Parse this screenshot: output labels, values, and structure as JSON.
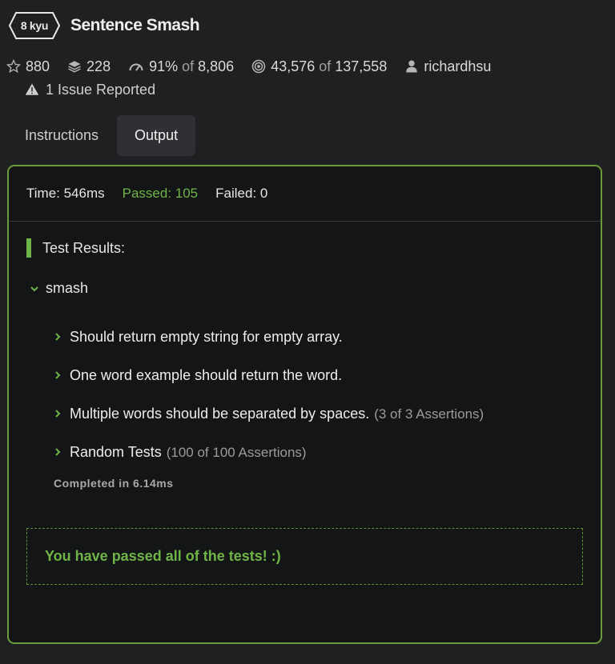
{
  "kata": {
    "rank": "8 kyu",
    "title": "Sentence Smash"
  },
  "stats": {
    "stars": "880",
    "collections": "228",
    "satisfaction_pct": "91%",
    "satisfaction_of": "of",
    "satisfaction_total": "8,806",
    "completed": "43,576",
    "completed_of": "of",
    "attempted": "137,558",
    "author": "richardhsu"
  },
  "issues": "1 Issue Reported",
  "tabs": [
    {
      "label": "Instructions",
      "active": false
    },
    {
      "label": "Output",
      "active": true
    }
  ],
  "summary": {
    "time": "Time: 546ms",
    "passed": "Passed: 105",
    "failed": "Failed: 0"
  },
  "results": {
    "heading": "Test Results:",
    "describe": "smash",
    "tests": [
      {
        "title": "Should return empty string for empty array.",
        "assertions": ""
      },
      {
        "title": "One word example should return the word.",
        "assertions": ""
      },
      {
        "title": "Multiple words should be separated by spaces.",
        "assertions": "(3 of 3 Assertions)"
      },
      {
        "title": "Random Tests",
        "assertions": "(100 of 100 Assertions)"
      }
    ],
    "completed": "Completed in 6.14ms"
  },
  "success_message": "You have passed all of the tests! :)",
  "colors": {
    "accent_green": "#6fb447",
    "panel_border": "#6b9a3a",
    "background": "#1f2022"
  },
  "icons": [
    "star-icon",
    "layers-icon",
    "gauge-icon",
    "target-icon",
    "user-icon",
    "warning-icon",
    "chevron-down-icon",
    "chevron-right-icon"
  ]
}
